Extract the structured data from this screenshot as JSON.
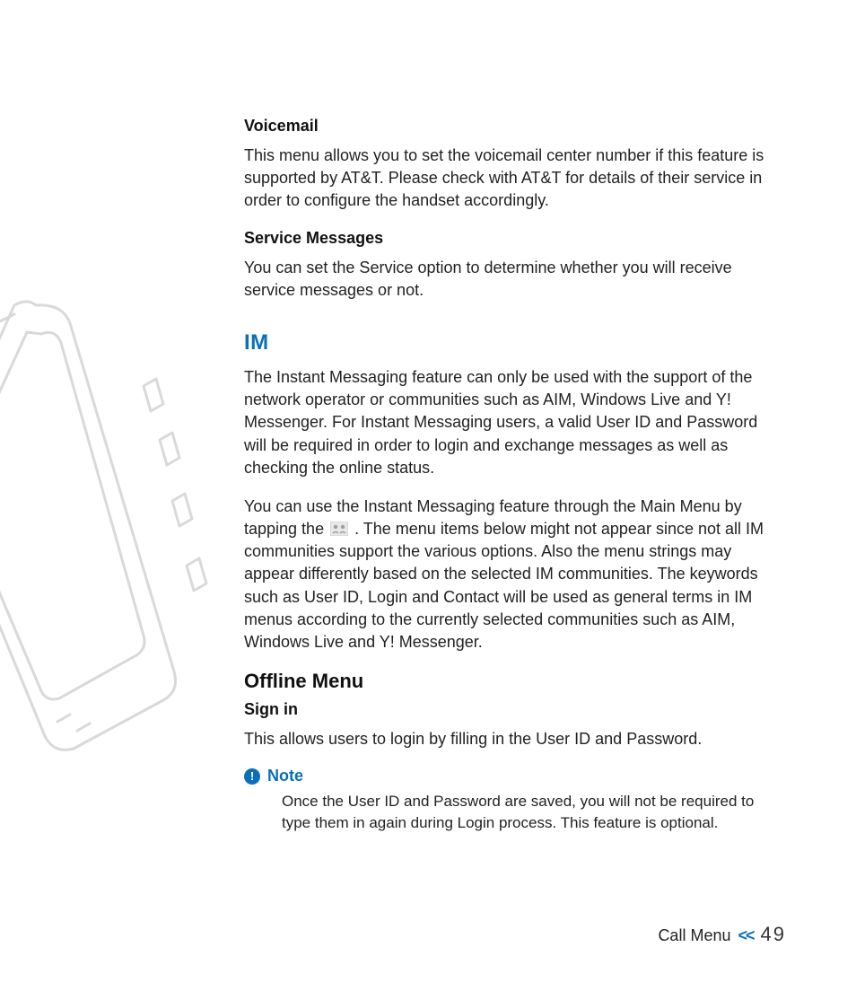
{
  "sections": {
    "voicemail": {
      "heading": "Voicemail",
      "body": "This menu allows you to set the voicemail center number if this feature is supported by AT&T. Please check with AT&T for details of their service in order to configure the handset accordingly."
    },
    "service_messages": {
      "heading": "Service Messages",
      "body": "You can set the Service option to determine whether you will receive service messages or not."
    },
    "im": {
      "heading": "IM",
      "para1": "The Instant Messaging feature can only be used with the support of the network operator or communities such as AIM, Windows Live and Y! Messenger. For Instant Messaging users, a valid User ID and Password will be required in order to login and exchange messages as well as checking the online status.",
      "para2_pre": "You can use the Instant Messaging feature through the Main Menu by tapping the ",
      "para2_post": ". The menu items below might not appear since not all IM communities support the various options. Also the menu strings may appear differently based on the selected IM communities. The keywords such as User ID, Login and Contact will be used as general terms in IM menus according to the currently selected communities such as AIM, Windows Live and Y! Messenger."
    },
    "offline": {
      "heading": "Offline Menu",
      "signin_heading": "Sign in",
      "signin_body": "This allows users to login by filling in the User ID and Password."
    },
    "note": {
      "label": "Note",
      "body": "Once the User ID and Password are saved, you will not be required to type them in again during Login process. This feature is optional."
    }
  },
  "footer": {
    "section": "Call Menu",
    "chevrons": "<<",
    "page": "49"
  }
}
